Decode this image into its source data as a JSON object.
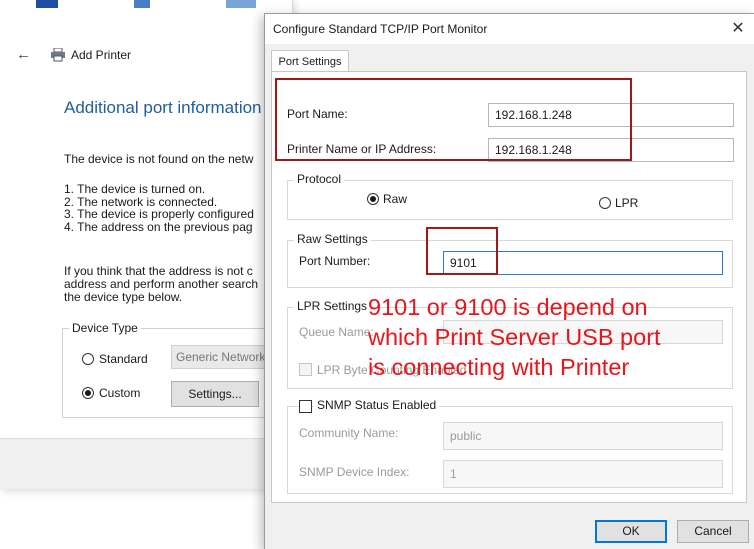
{
  "wizard": {
    "back_arrow": "←",
    "title": "Add Printer",
    "heading": "Additional port information r",
    "intro": "The device is not found on the netw",
    "checklist": [
      "1.  The device is turned on.",
      "2.  The network is connected.",
      "3.  The device is properly configured",
      "4.  The address on the previous pag"
    ],
    "help_lines": [
      "If you think that the address is not c",
      "address and perform another search",
      "the device type below."
    ],
    "device_type": {
      "legend": "Device Type",
      "standard_label": "Standard",
      "standard_value": "Generic Network",
      "custom_label": "Custom",
      "settings_button": "Settings..."
    }
  },
  "dialog": {
    "title": "Configure Standard TCP/IP Port Monitor",
    "close_glyph": "✕",
    "tab": "Port Settings",
    "port_name_label": "Port Name:",
    "port_name_value": "192.168.1.248",
    "printer_name_label": "Printer Name or IP Address:",
    "printer_name_value": "192.168.1.248",
    "protocol": {
      "legend": "Protocol",
      "raw_label": "Raw",
      "lpr_label": "LPR"
    },
    "raw_settings": {
      "legend": "Raw Settings",
      "port_number_label": "Port Number:",
      "port_number_value": "9101"
    },
    "lpr_settings": {
      "legend": "LPR Settings",
      "queue_name_label": "Queue Name:",
      "byte_counting_label": "LPR Byte Counting Enabled"
    },
    "snmp": {
      "enabled_label": "SNMP Status Enabled",
      "community_label": "Community Name:",
      "community_value": "public",
      "device_index_label": "SNMP Device Index:",
      "device_index_value": "1"
    },
    "ok_button": "OK",
    "cancel_button": "Cancel"
  },
  "annotation": {
    "lines": [
      "9101 or 9100 is depend on",
      "which Print Server USB port",
      "is connecting with Printer"
    ],
    "color": "#e8151b"
  },
  "colors": {
    "highlight_box": "#a01818",
    "heading": "#1f5e9c",
    "focus_border": "#2b7bd4"
  }
}
